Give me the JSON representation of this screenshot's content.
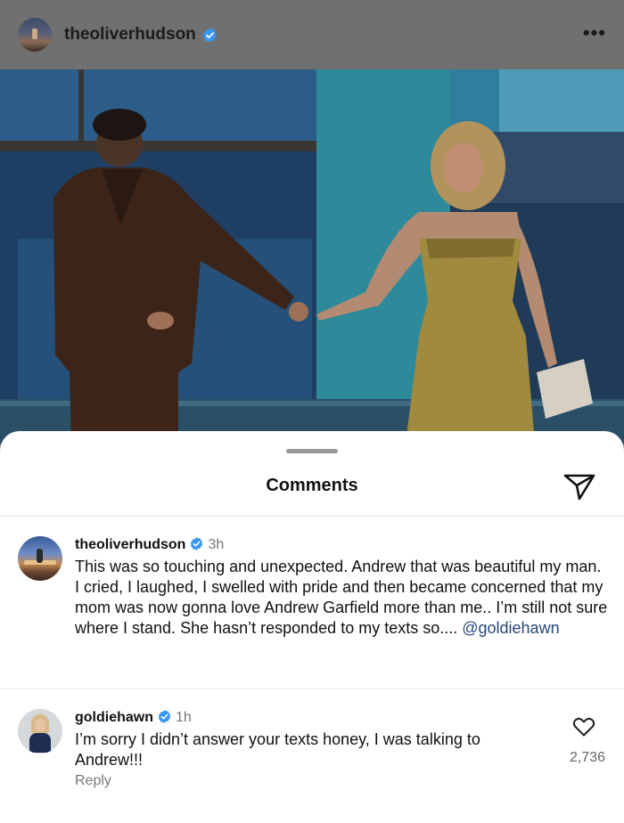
{
  "post": {
    "username": "theoliverhudson",
    "verified": true,
    "more_icon": "more-horizontal-icon"
  },
  "comments_sheet": {
    "title": "Comments",
    "share_icon": "paper-plane-icon"
  },
  "comments": [
    {
      "username": "theoliverhudson",
      "verified": true,
      "time": "3h",
      "text": "This was so touching and unexpected. Andrew that was beautiful my man. I cried, I laughed, I swelled with pride and then became concerned that my mom was now gonna love Andrew Garfield more than me.. I’m still not sure where I stand. She hasn’t responded to my texts so.... ",
      "mention": "@goldiehawn"
    },
    {
      "username": "goldiehawn",
      "verified": true,
      "time": "1h",
      "text": "I’m sorry I didn’t answer your texts honey, I was talking to Andrew!!!",
      "reply_label": "Reply",
      "likes": "2,736",
      "like_icon": "heart-icon"
    }
  ],
  "colors": {
    "verified_badge": "#3897f0",
    "mention": "#27477a",
    "dim_overlay": "#707070"
  }
}
